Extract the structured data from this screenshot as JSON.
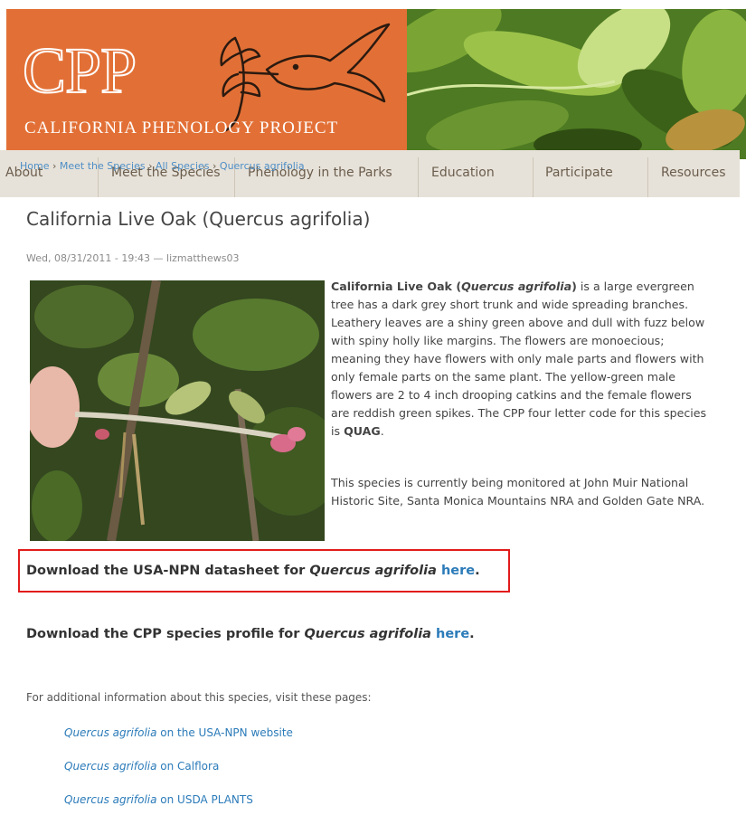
{
  "header": {
    "logo_text": "CPP",
    "logo_subtitle": "CALIFORNIA PHENOLOGY PROJECT"
  },
  "nav": {
    "items": [
      {
        "label": "About"
      },
      {
        "label": "Meet the Species"
      },
      {
        "label": "Phenology in the Parks"
      },
      {
        "label": "Education"
      },
      {
        "label": "Participate"
      },
      {
        "label": "Resources"
      }
    ]
  },
  "breadcrumb": {
    "items": [
      "Home",
      "Meet the Species",
      "All Species",
      "Quercus agrifolia"
    ],
    "separator": "›"
  },
  "page": {
    "title": "California Live Oak (Quercus agrifolia)",
    "meta": "Wed, 08/31/2011 - 19:43 — lizmatthews03",
    "desc": {
      "bold_name": "California Live Oak (",
      "bold_italic": "Quercus agrifolia",
      "bold_close": ")",
      "text": " is a large evergreen tree has a dark grey short trunk and wide spreading branches. Leathery leaves are a shiny green above and dull with fuzz below with spiny holly like margins. The flowers are monoecious; meaning they have flowers with only male parts and flowers with only female parts on the same plant. The yellow-green male flowers are 2 to 4 inch drooping catkins and the female flowers are reddish green spikes. The CPP four letter code for this species is ",
      "code": "QUAG",
      "end": "."
    },
    "monitoring": "This species is currently being monitored at John Muir National Historic Site, Santa Monica Mountains NRA and Golden Gate NRA.",
    "download_npn": {
      "prefix": "Download the USA-NPN datasheet for ",
      "species": "Quercus agrifolia",
      "link": "here",
      "suffix": "."
    },
    "download_cpp": {
      "prefix": "Download the CPP species profile for ",
      "species": "Quercus agrifolia",
      "link": "here",
      "suffix": "."
    },
    "additional_info": "For additional information about this species, visit these pages:",
    "links": [
      {
        "species": "Quercus agrifolia",
        "text": " on the USA-NPN website"
      },
      {
        "species": "Quercus agrifolia",
        "text": " on Calflora"
      },
      {
        "species": "Quercus agrifolia",
        "text": " on USDA PLANTS"
      }
    ]
  },
  "colors": {
    "brand_orange": "#e27036",
    "nav_bg": "#e7e2d9",
    "link_blue": "#2b7bb9",
    "highlight_red": "#e21b1b"
  }
}
